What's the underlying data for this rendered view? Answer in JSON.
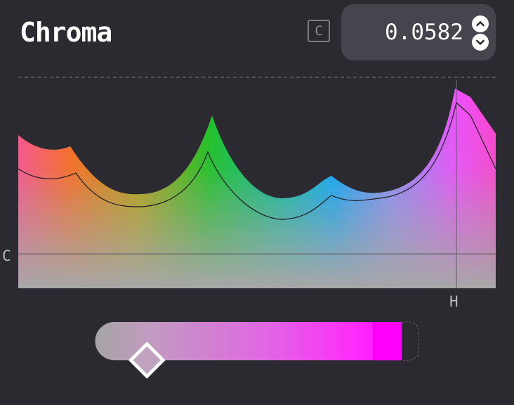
{
  "title": "Chroma",
  "shortcut_key": "C",
  "value": "0.0582",
  "axis": {
    "y_label": "C",
    "x_label": "H"
  },
  "slider": {
    "fraction": 0.16
  },
  "colors": {
    "background": "#2b2a30",
    "field_bg": "#46444d",
    "accent": "#ff00ff",
    "text": "#ffffff"
  },
  "icons": {
    "increment": "chevron-up-icon",
    "decrement": "chevron-down-icon",
    "handle": "diamond-handle-icon"
  }
}
